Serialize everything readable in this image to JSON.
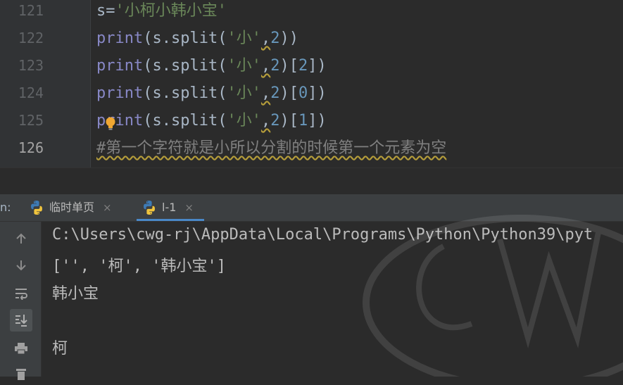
{
  "editor": {
    "lines": [
      {
        "num": "121",
        "parts": [
          [
            "plain",
            "s="
          ],
          [
            "str",
            "'小柯小韩小宝'"
          ]
        ]
      },
      {
        "num": "122",
        "parts": [
          [
            "kw",
            "print"
          ],
          [
            "plain",
            "(s.split("
          ],
          [
            "str",
            "'小'"
          ],
          [
            "plain",
            ","
          ],
          [
            "num",
            "2"
          ],
          [
            "plain",
            "))"
          ]
        ]
      },
      {
        "num": "123",
        "parts": [
          [
            "kw",
            "print"
          ],
          [
            "plain",
            "(s.split("
          ],
          [
            "str",
            "'小'"
          ],
          [
            "plain",
            ","
          ],
          [
            "num",
            "2"
          ],
          [
            "plain",
            ")["
          ],
          [
            "num",
            "2"
          ],
          [
            "plain",
            "])"
          ]
        ]
      },
      {
        "num": "124",
        "parts": [
          [
            "kw",
            "print"
          ],
          [
            "plain",
            "(s.split("
          ],
          [
            "str",
            "'小'"
          ],
          [
            "plain",
            ","
          ],
          [
            "num",
            "2"
          ],
          [
            "plain",
            ")["
          ],
          [
            "num",
            "0"
          ],
          [
            "plain",
            "])"
          ]
        ]
      },
      {
        "num": "125",
        "parts": [
          [
            "kw",
            "print"
          ],
          [
            "plain",
            "(s.split("
          ],
          [
            "str",
            "'小'"
          ],
          [
            "plain",
            ","
          ],
          [
            "num",
            "2"
          ],
          [
            "plain",
            ")["
          ],
          [
            "num",
            "1"
          ],
          [
            "plain",
            "])"
          ]
        ]
      },
      {
        "num": "126",
        "parts": [
          [
            "cmt",
            "#第一个字符就是小所以分割的时候第一个元素为空"
          ]
        ]
      }
    ],
    "active_line": "126"
  },
  "run_window": {
    "prefix": "n:",
    "tabs": [
      {
        "label": "临时单页",
        "close": "×"
      },
      {
        "label": "l-1",
        "close": "×"
      }
    ]
  },
  "console": {
    "lines": [
      "C:\\Users\\cwg-rj\\AppData\\Local\\Programs\\Python\\Python39\\pyt",
      "['', '柯', '韩小宝']",
      "韩小宝",
      "",
      "柯"
    ]
  },
  "colors": {
    "editor_bg": "#2b2b2b",
    "keyword": "#8888c6",
    "string": "#6a8759",
    "number": "#6897bb",
    "comment": "#808080",
    "tab_underline": "#4a88c7"
  },
  "icons": [
    "lightbulb-icon",
    "python-icon",
    "close-icon",
    "up-arrow-icon",
    "down-arrow-icon",
    "soft-wrap-icon",
    "scroll-to-end-icon",
    "print-icon",
    "trash-icon"
  ]
}
